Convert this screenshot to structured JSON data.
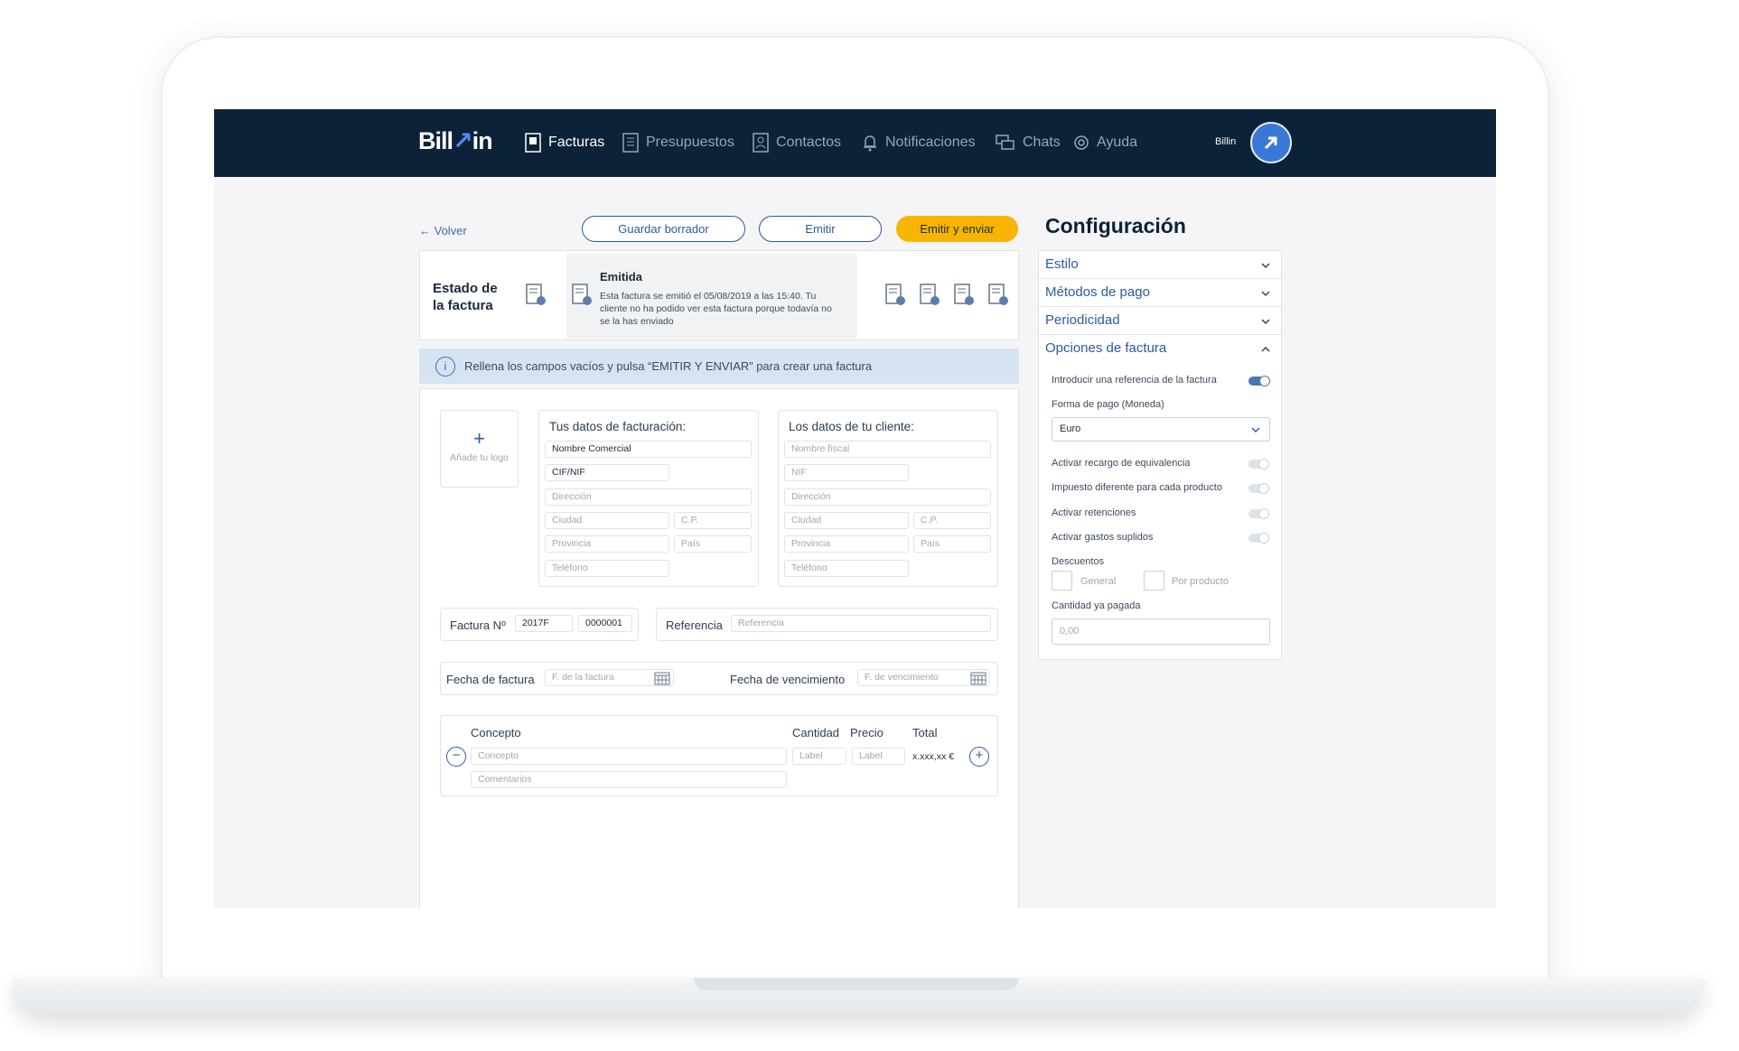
{
  "nav": {
    "logo": "Billin",
    "items": [
      {
        "label": "Facturas",
        "icon": "invoice-icon"
      },
      {
        "label": "Presupuestos",
        "icon": "budget-icon"
      },
      {
        "label": "Contactos",
        "icon": "contacts-icon"
      },
      {
        "label": "Notificaciones",
        "icon": "bell-icon"
      },
      {
        "label": "Chats",
        "icon": "chat-icon"
      },
      {
        "label": "Ayuda",
        "icon": "help-icon"
      }
    ],
    "user": "Billin"
  },
  "toolbar": {
    "back": "← Volver",
    "save_draft": "Guardar borrador",
    "emit": "Emitir",
    "emit_send": "Emitir y enviar"
  },
  "estado": {
    "title_line1": "Estado de",
    "title_line2": "la factura",
    "status": "Emitida",
    "description": "Esta factura se emitió el 05/08/2019 a las 15:40. Tu cliente no ha podido ver esta factura porque todavía no se la has enviado"
  },
  "info": {
    "message": "Rellena los campos vacíos y pulsa “EMITIR Y ENVIAR” para crear una factura"
  },
  "logo_box": {
    "plus": "+",
    "label": "Añade tu logo"
  },
  "my_data": {
    "title": "Tus datos de facturación:",
    "nombre": "Nombre Comercial",
    "cif": "CIF/NIF",
    "direccion": "Dirección",
    "ciudad": "Ciudad",
    "cp": "C.P.",
    "provincia": "Provincia",
    "pais": "País",
    "telefono": "Teléfono"
  },
  "client_data": {
    "title": "Los datos de tu cliente:",
    "nombre": "Nombre fiscal",
    "nif": "NIF",
    "direccion": "Dirección",
    "ciudad": "Ciudad",
    "cp": "C.P.",
    "provincia": "Provincia",
    "pais": "País",
    "telefono": "Teléfono"
  },
  "invoice": {
    "number_label": "Factura Nº",
    "series": "2017F",
    "number": "0000001",
    "ref_label": "Referencia",
    "ref_placeholder": "Referencia",
    "date_label": "Fecha de factura",
    "date_placeholder": "F. de la factura",
    "due_label": "Fecha de vencimiento",
    "due_placeholder": "F. de vencimiento"
  },
  "lines": {
    "concepto_header": "Concepto",
    "cantidad_header": "Cantidad",
    "precio_header": "Precio",
    "total_header": "Total",
    "concepto_placeholder": "Concepto",
    "cantidad_placeholder": "Label",
    "precio_placeholder": "Label",
    "total_value": "x.xxx,xx €",
    "comentarios_placeholder": "Comentarios",
    "remove": "−",
    "add": "+"
  },
  "config": {
    "title": "Configuración",
    "sections": [
      "Estilo",
      "Métodos de pago",
      "Periodicidad",
      "Opciones de factura"
    ],
    "options": {
      "referencia": "Introducir una referencia de la factura",
      "forma_pago": "Forma de pago (Moneda)",
      "moneda": "Euro",
      "recargo": "Activar recargo de equivalencia",
      "impuesto": "Impuesto diferente para cada producto",
      "retenciones": "Activar retenciones",
      "suplidos": "Activar gastos suplidos",
      "descuentos": "Descuentos",
      "general": "General",
      "por_producto": "Por producto",
      "cantidad_pagada": "Cantidad ya pagada",
      "cantidad_value": "0,00"
    }
  }
}
